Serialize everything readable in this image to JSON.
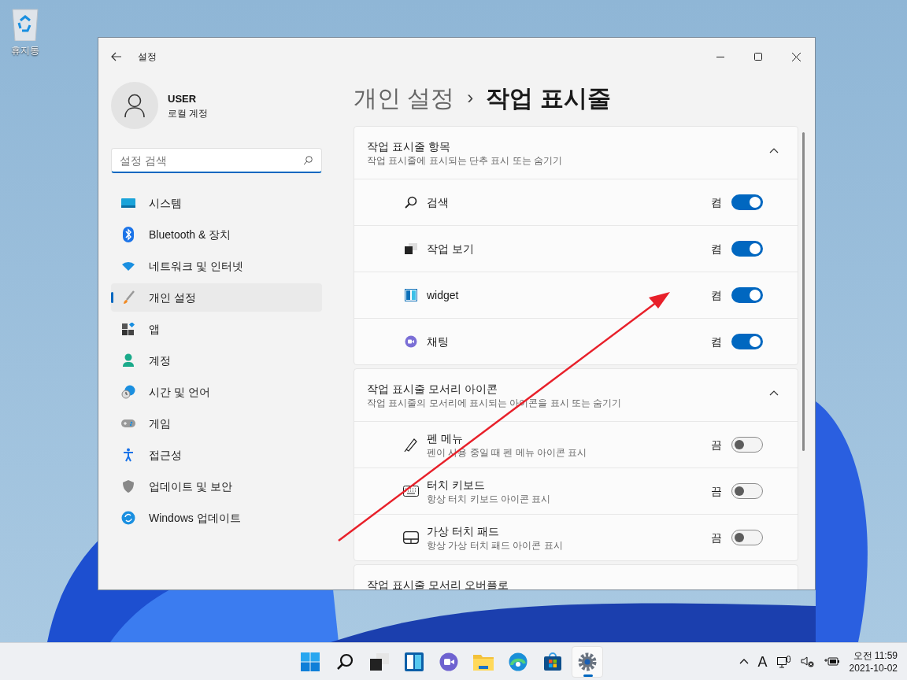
{
  "desktop": {
    "recycle_bin": {
      "label": "휴지통"
    }
  },
  "window": {
    "title": "설정"
  },
  "user": {
    "name": "USER",
    "subtitle": "로컬 계정"
  },
  "search": {
    "placeholder": "설정 검색"
  },
  "nav": [
    {
      "label": "시스템",
      "selected": false
    },
    {
      "label": "Bluetooth & 장치",
      "selected": false
    },
    {
      "label": "네트워크 및 인터넷",
      "selected": false
    },
    {
      "label": "개인 설정",
      "selected": true
    },
    {
      "label": "앱",
      "selected": false
    },
    {
      "label": "계정",
      "selected": false
    },
    {
      "label": "시간 및 언어",
      "selected": false
    },
    {
      "label": "게임",
      "selected": false
    },
    {
      "label": "접근성",
      "selected": false
    },
    {
      "label": "업데이트 및 보안",
      "selected": false
    },
    {
      "label": "Windows 업데이트",
      "selected": false
    }
  ],
  "breadcrumb": {
    "parent": "개인 설정",
    "separator": "›",
    "current": "작업 표시줄"
  },
  "sections": [
    {
      "title": "작업 표시줄 항목",
      "subtitle": "작업 표시줄에 표시되는 단추 표시 또는 숨기기",
      "expanded": true,
      "rows": [
        {
          "label": "검색",
          "state_label": "켬",
          "on": true
        },
        {
          "label": "작업 보기",
          "state_label": "켬",
          "on": true
        },
        {
          "label": "widget",
          "state_label": "켬",
          "on": true
        },
        {
          "label": "채팅",
          "state_label": "켬",
          "on": true
        }
      ]
    },
    {
      "title": "작업 표시줄 모서리 아이콘",
      "subtitle": "작업 표시줄의 모서리에 표시되는 아이콘을 표시 또는 숨기기",
      "expanded": true,
      "rows": [
        {
          "label": "펜 메뉴",
          "description": "펜이 사용 중일 때 펜 메뉴 아이콘 표시",
          "state_label": "끔",
          "on": false
        },
        {
          "label": "터치 키보드",
          "description": "항상 터치 키보드 아이콘 표시",
          "state_label": "끔",
          "on": false
        },
        {
          "label": "가상 터치 패드",
          "description": "항상 가상 터치 패드 아이콘 표시",
          "state_label": "끔",
          "on": false
        }
      ]
    },
    {
      "title": "작업 표시줄 모서리 오버플로"
    }
  ],
  "taskbar": {
    "apps": [
      {
        "active": false
      },
      {
        "active": false
      },
      {
        "active": false
      },
      {
        "active": false
      },
      {
        "active": false
      },
      {
        "active": false
      },
      {
        "active": false
      },
      {
        "active": false
      },
      {
        "active": true
      }
    ],
    "input_indicator": "A",
    "time": "오전 11:59",
    "date": "2021-10-02"
  }
}
